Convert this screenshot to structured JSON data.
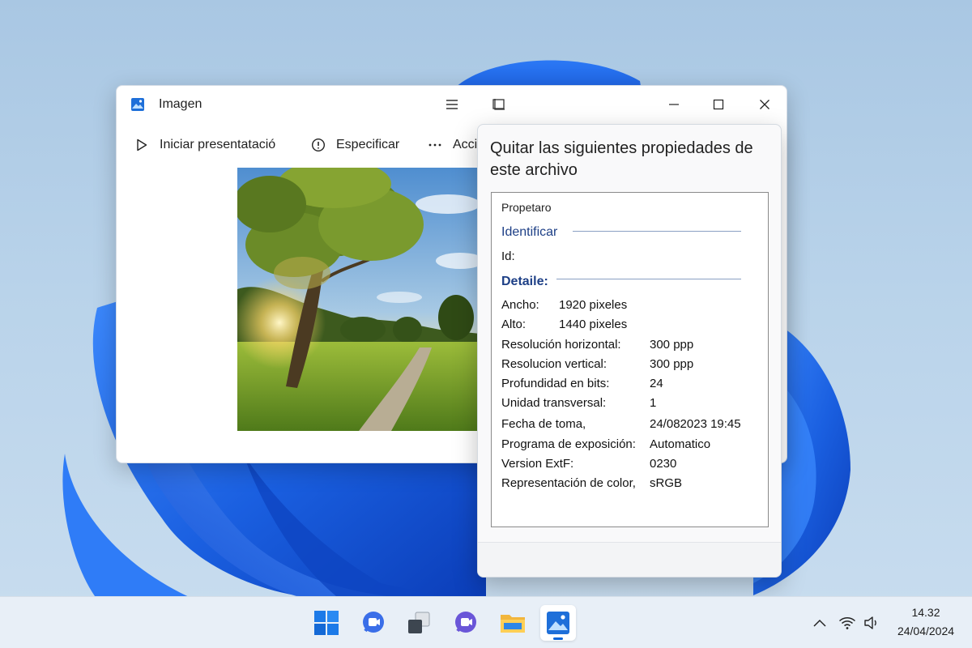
{
  "window": {
    "title": "Imagen",
    "icons": {
      "app": "image-app-icon",
      "menu": "hamburger-menu-icon",
      "crop": "crop-icon",
      "minimize": "minimize-icon",
      "maximize": "maximize-icon",
      "close": "close-icon"
    }
  },
  "toolbar": {
    "slideshow_label": "Iniciar presentatació",
    "specify_label": "Especificar",
    "actions_label": "Acci"
  },
  "dialog": {
    "title": "Quitar las siguientes propiedades de este archivo",
    "owner_label": "Propetaro",
    "identify_heading": "Identificar",
    "id_label": "Id:",
    "details_heading": "Detaile:",
    "properties": [
      {
        "label": "Ancho:",
        "value": "1920 pixeles"
      },
      {
        "label": "Alto:",
        "value": "1440 pixeles"
      },
      {
        "label": "Resolución horizontal:",
        "value": "300 ppp"
      },
      {
        "label": "Resolucion vertical:",
        "value": "300 ppp"
      },
      {
        "label": "Profundidad en bits:",
        "value": "24"
      },
      {
        "label": "Unidad transversal:",
        "value": "1"
      },
      {
        "label": "Fecha de toma,",
        "value": "24/082023 19:45"
      },
      {
        "label": "Programa de exposición:",
        "value": "Automatico"
      },
      {
        "label": "Version ExtF:",
        "value": "0230"
      },
      {
        "label": "Representación de color,",
        "value": "sRGB"
      }
    ]
  },
  "taskbar": {
    "apps": [
      "start-icon",
      "chat-icon",
      "task-view-icon",
      "teams-icon",
      "file-explorer-icon",
      "photos-icon"
    ],
    "tray": [
      "chevron-up-icon",
      "wifi-icon",
      "speaker-icon"
    ],
    "time": "14.32",
    "date": "24/04/2024"
  },
  "colors": {
    "accent": "#0a64d8",
    "section_heading": "#1d3f86",
    "wallpaper_bloom": "#1a5fe0"
  }
}
